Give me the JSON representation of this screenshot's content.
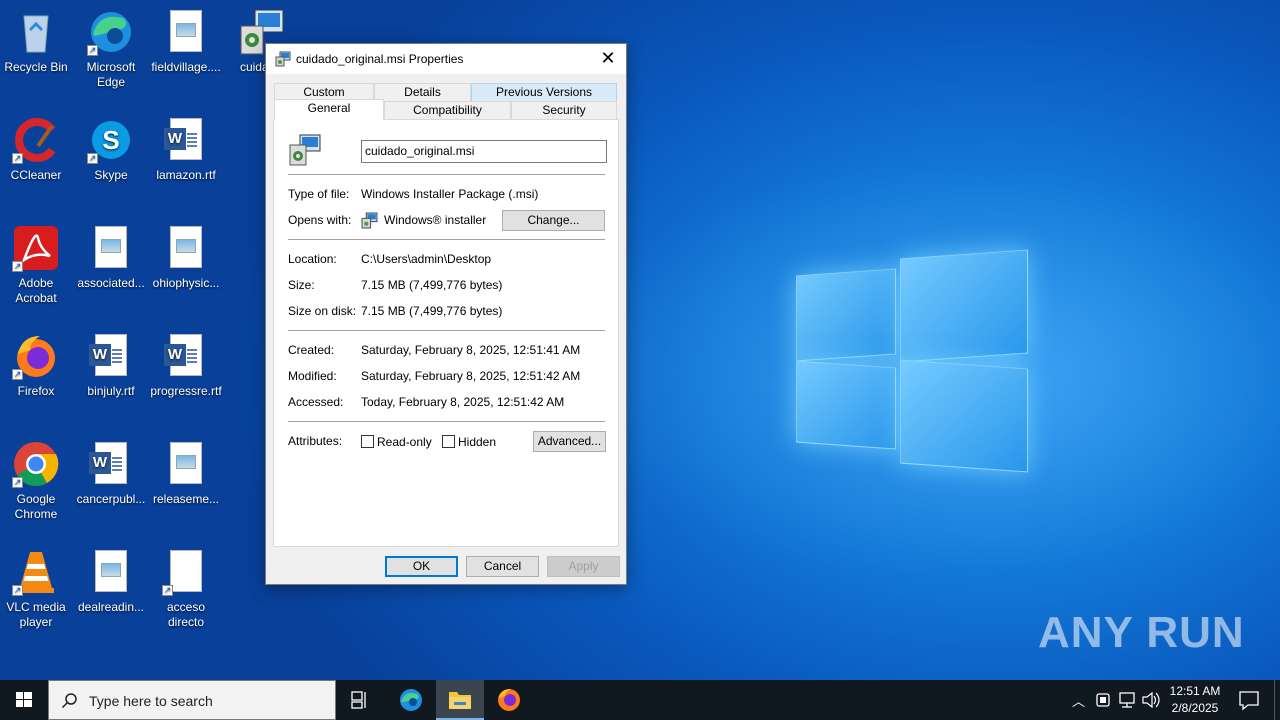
{
  "desktop": {
    "icons": [
      {
        "label": "Recycle Bin",
        "icon": "recycle-bin-icon"
      },
      {
        "label": "Microsoft Edge",
        "icon": "edge-icon"
      },
      {
        "label": "fieldvillage....",
        "icon": "image-file-icon"
      },
      {
        "label": "cuidado",
        "icon": "msi-installer-icon"
      },
      {
        "label": "CCleaner",
        "icon": "ccleaner-icon"
      },
      {
        "label": "Skype",
        "icon": "skype-icon"
      },
      {
        "label": "lamazon.rtf",
        "icon": "word-doc-icon"
      },
      {
        "label": "Adobe Acrobat",
        "icon": "acrobat-icon"
      },
      {
        "label": "associated...",
        "icon": "image-file-icon"
      },
      {
        "label": "ohiophysic...",
        "icon": "image-file-icon"
      },
      {
        "label": "Firefox",
        "icon": "firefox-icon"
      },
      {
        "label": "binjuly.rtf",
        "icon": "word-doc-icon"
      },
      {
        "label": "progressre.rtf",
        "icon": "word-doc-icon"
      },
      {
        "label": "Google Chrome",
        "icon": "chrome-icon"
      },
      {
        "label": "cancerpubl...",
        "icon": "word-doc-icon"
      },
      {
        "label": "releaseme...",
        "icon": "image-file-icon"
      },
      {
        "label": "VLC media player",
        "icon": "vlc-icon"
      },
      {
        "label": "dealreadin...",
        "icon": "image-file-icon"
      },
      {
        "label": "acceso directo",
        "icon": "blank-file-icon"
      }
    ]
  },
  "dialog": {
    "title": "cuidado_original.msi Properties",
    "tabs_row1": [
      "Custom",
      "Details",
      "Previous Versions"
    ],
    "tabs_row2": [
      "General",
      "Compatibility",
      "Security"
    ],
    "active_tab": "General",
    "filename": "cuidado_original.msi",
    "type_label": "Type of file:",
    "type_value": "Windows Installer Package (.msi)",
    "opens_label": "Opens with:",
    "opens_value": "Windows® installer",
    "change_button": "Change...",
    "location_label": "Location:",
    "location_value": "C:\\Users\\admin\\Desktop",
    "size_label": "Size:",
    "size_value": "7.15 MB (7,499,776 bytes)",
    "disk_label": "Size on disk:",
    "disk_value": "7.15 MB (7,499,776 bytes)",
    "created_label": "Created:",
    "created_value": "Saturday, February 8, 2025, 12:51:41 AM",
    "modified_label": "Modified:",
    "modified_value": "Saturday, February 8, 2025, 12:51:42 AM",
    "accessed_label": "Accessed:",
    "accessed_value": "Today, February 8, 2025, 12:51:42 AM",
    "attributes_label": "Attributes:",
    "readonly_label": "Read-only",
    "hidden_label": "Hidden",
    "advanced_button": "Advanced...",
    "ok_button": "OK",
    "cancel_button": "Cancel",
    "apply_button": "Apply"
  },
  "taskbar": {
    "search_placeholder": "Type here to search",
    "time": "12:51 AM",
    "date": "2/8/2025"
  },
  "watermark": "ANY RUN",
  "colors": {
    "accent": "#0078d7",
    "taskbar": "#101820",
    "wallpaper": "#0a59be"
  }
}
